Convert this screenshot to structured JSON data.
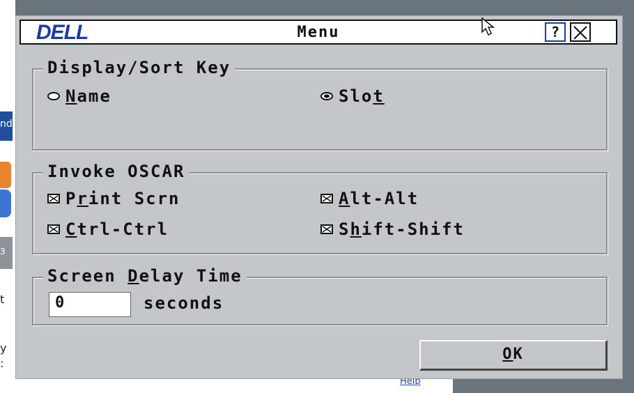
{
  "dialog": {
    "logo": "DELL",
    "title": "Menu",
    "help_label": "?"
  },
  "display_sort": {
    "legend": "Display/Sort Key",
    "options": [
      {
        "label_pre": "",
        "label_ul": "N",
        "label_post": "ame",
        "selected": false
      },
      {
        "label_pre": "Slo",
        "label_ul": "t",
        "label_post": "",
        "selected": true
      }
    ]
  },
  "invoke_oscar": {
    "legend": "Invoke OSCAR",
    "options": [
      {
        "label_pre": "P",
        "label_ul": "r",
        "label_post": "int Scrn",
        "checked": true
      },
      {
        "label_pre": "",
        "label_ul": "A",
        "label_post": "lt-Alt",
        "checked": true
      },
      {
        "label_pre": "",
        "label_ul": "C",
        "label_post": "trl-Ctrl",
        "checked": true
      },
      {
        "label_pre": "S",
        "label_ul": "h",
        "label_post": "ift-Shift",
        "checked": true
      }
    ]
  },
  "screen_delay": {
    "legend_pre": "Screen ",
    "legend_ul": "D",
    "legend_post": "elay Time",
    "value": "0",
    "unit": "seconds"
  },
  "ok_button": {
    "label_ul": "O",
    "label_post": "K"
  },
  "background": {
    "fragments": [
      "nd",
      "3",
      "t",
      "y",
      ":"
    ],
    "link_text": "Help"
  },
  "colors": {
    "dialog_bg": "#c3c7c9",
    "logo_blue": "#1a3aa8",
    "desktop": "#6a747c"
  }
}
